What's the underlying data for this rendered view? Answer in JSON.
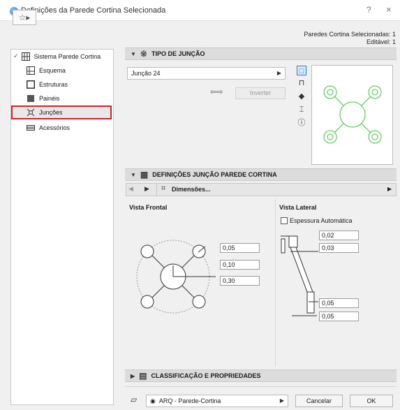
{
  "window": {
    "title": "Definições da Parede Cortina Selecionada",
    "help_label": "?",
    "close_label": "×"
  },
  "selection_info": {
    "line1": "Paredes Cortina Selecionadas: 1",
    "line2": "Editável: 1"
  },
  "tree": {
    "root_label": "Sistema Parede Cortina",
    "items": [
      {
        "label": "Esquema",
        "icon": "scheme-icon"
      },
      {
        "label": "Estruturas",
        "icon": "frames-icon"
      },
      {
        "label": "Painéis",
        "icon": "panels-icon"
      },
      {
        "label": "Junções",
        "icon": "junctions-icon",
        "selected": true
      },
      {
        "label": "Acessórios",
        "icon": "accessories-icon"
      }
    ]
  },
  "junction_type": {
    "heading": "TIPO DE JUNÇÃO",
    "dropdown_value": "Junção 24",
    "invert_label": "Inverter"
  },
  "junction_settings": {
    "heading": "DEFINIÇÕES JUNÇÃO PAREDE CORTINA",
    "page_dropdown": "Dimensões...",
    "front_view_label": "Vista Frontal",
    "side_view_label": "Vista Lateral",
    "auto_thickness_label": "Espessura Automática",
    "auto_thickness_checked": false,
    "front_values": [
      "0,05",
      "0,10",
      "0,30"
    ],
    "side_values_top": [
      "0,02",
      "0,03"
    ],
    "side_values_bottom": [
      "0,05",
      "0,05"
    ]
  },
  "classification": {
    "heading": "CLASSIFICAÇÃO E PROPRIEDADES"
  },
  "footer": {
    "layer_value": "ARQ - Parede-Cortina",
    "cancel_label": "Cancelar",
    "ok_label": "OK"
  },
  "colors": {
    "accent": "#2a76d2",
    "highlight_border": "#d0212e",
    "preview_green": "#3cc93c"
  }
}
